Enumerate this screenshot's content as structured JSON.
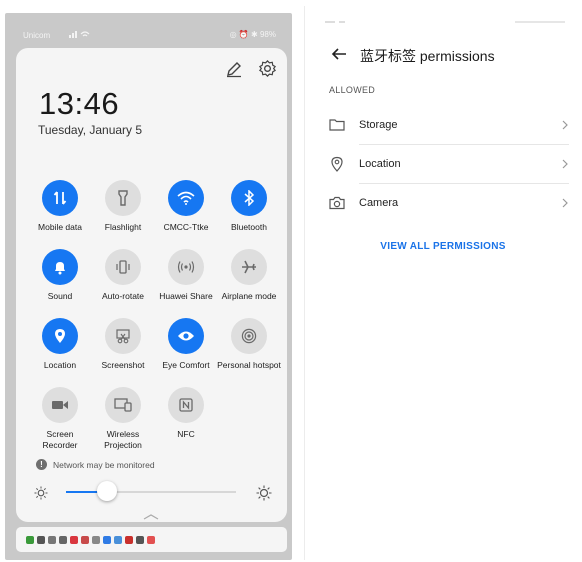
{
  "left_phone": {
    "status_bar": {
      "carrier": "Unicom",
      "right_indicators": "◎ ⏰ ✱ 98%"
    },
    "clock": {
      "time": "13:46",
      "date": "Tuesday, January 5"
    },
    "icons": {
      "edit": "pencil-icon",
      "settings": "gear-icon"
    },
    "tiles": [
      {
        "label": "Mobile data",
        "state": "on",
        "icon": "data-arrows-icon"
      },
      {
        "label": "Flashlight",
        "state": "off",
        "icon": "flashlight-icon"
      },
      {
        "label": "CMCC-Ttke",
        "state": "on",
        "icon": "wifi-icon"
      },
      {
        "label": "Bluetooth",
        "state": "on",
        "icon": "bluetooth-icon"
      },
      {
        "label": "Sound",
        "state": "on",
        "icon": "bell-icon"
      },
      {
        "label": "Auto-rotate",
        "state": "off",
        "icon": "rotate-icon"
      },
      {
        "label": "Huawei Share",
        "state": "off",
        "icon": "share-waves-icon"
      },
      {
        "label": "Airplane mode",
        "state": "off",
        "icon": "airplane-icon"
      },
      {
        "label": "Location",
        "state": "on",
        "icon": "location-pin-icon"
      },
      {
        "label": "Screenshot",
        "state": "off",
        "icon": "scissors-icon"
      },
      {
        "label": "Eye Comfort",
        "state": "on",
        "icon": "eye-icon"
      },
      {
        "label": "Personal hotspot",
        "state": "off",
        "icon": "hotspot-icon"
      },
      {
        "label": "Screen Recorder",
        "state": "off",
        "icon": "video-camera-icon"
      },
      {
        "label": "Wireless Projection",
        "state": "off",
        "icon": "projection-icon"
      },
      {
        "label": "NFC",
        "state": "off",
        "icon": "nfc-icon"
      }
    ],
    "network_notice": "Network may be monitored",
    "brightness": {
      "level_percent": 24
    },
    "colors": {
      "accent": "#1677f2",
      "tile_off": "#dedede",
      "background": "#c9c9c9"
    }
  },
  "right_page": {
    "title": "蓝牙标签 permissions",
    "section_label": "ALLOWED",
    "permissions": [
      {
        "label": "Storage",
        "icon": "folder-icon"
      },
      {
        "label": "Location",
        "icon": "location-pin-icon"
      },
      {
        "label": "Camera",
        "icon": "camera-icon"
      }
    ],
    "view_all_label": "VIEW ALL PERMISSIONS",
    "colors": {
      "link": "#1a73e8"
    }
  }
}
